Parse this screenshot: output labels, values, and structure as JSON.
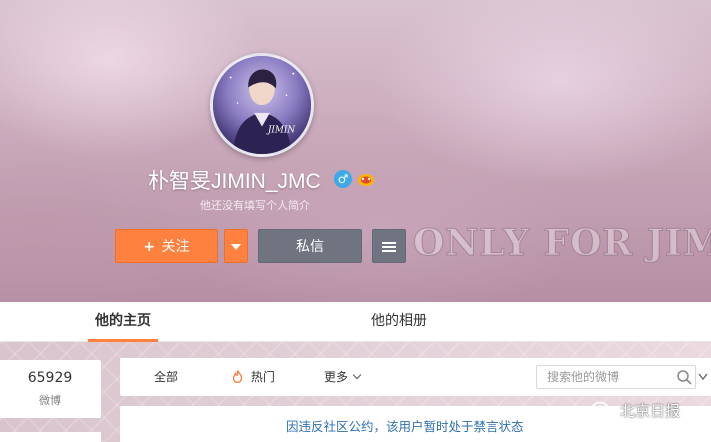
{
  "profile": {
    "username": "朴智旻JIMIN_JMC",
    "gender_symbol": "♂",
    "bio": "他还没有填写个人简介",
    "banner_text": "ONLY FOR JIMIN",
    "avatar_lettering": "JIMIN"
  },
  "actions": {
    "follow_plus": "+",
    "follow_label": "关注",
    "message_label": "私信"
  },
  "tabs": [
    {
      "label": "他的主页",
      "active": true
    },
    {
      "label": "他的相册",
      "active": false
    }
  ],
  "stats": {
    "weibo_count": "65929",
    "weibo_label": "微博"
  },
  "filters": {
    "all": "全部",
    "hot": "热门",
    "more": "更多"
  },
  "search": {
    "placeholder": "搜索他的微博",
    "value": ""
  },
  "notice": {
    "text": "因违反社区公约，该用户暂时处于禁言状态"
  },
  "watermark": {
    "text": "北京日报"
  },
  "colors": {
    "accent": "#ff8140",
    "notice_link": "#2f6fb0",
    "gray_button": "#6f7480",
    "gender_badge": "#3ea9e8"
  },
  "icons": [
    "gender-male-icon",
    "level-badge-icon",
    "plus-icon",
    "caret-down-icon",
    "menu-icon",
    "flame-icon",
    "chevron-down-icon",
    "search-icon",
    "wechat-icon"
  ]
}
